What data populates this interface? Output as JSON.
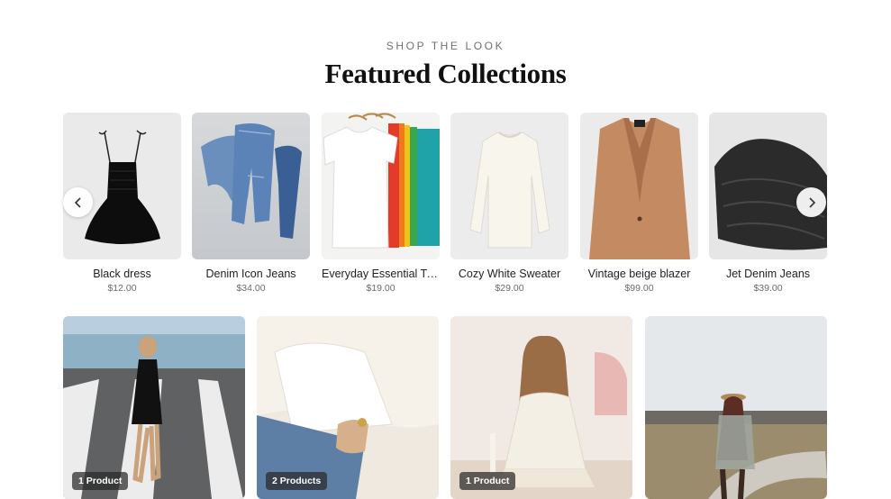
{
  "header": {
    "eyebrow": "SHOP THE LOOK",
    "title": "Featured Collections"
  },
  "carousel": {
    "prev_icon": "chevron-left-icon",
    "next_icon": "chevron-right-icon",
    "products": [
      {
        "name": "Black dress",
        "price": "$12.00",
        "image": "black dress"
      },
      {
        "name": "Denim Icon Jeans",
        "price": "$34.00",
        "image": "blue jeans"
      },
      {
        "name": "Everyday Essential T-...",
        "price": "$19.00",
        "image": "row of t-shirts"
      },
      {
        "name": "Cozy White Sweater",
        "price": "$29.00",
        "image": "white sweater"
      },
      {
        "name": "Vintage beige blazer",
        "price": "$99.00",
        "image": "beige blazer"
      },
      {
        "name": "Jet Denim Jeans",
        "price": "$39.00",
        "image": "folded black jeans"
      }
    ]
  },
  "looks": [
    {
      "badge": "1 Product",
      "image": "woman in black dress on crosswalk"
    },
    {
      "badge": "2 Products",
      "image": "white shirt and jeans close-up"
    },
    {
      "badge": "1 Product",
      "image": "woman in white sweater sitting"
    },
    {
      "badge": "",
      "image": "woman with hat walking on path"
    }
  ],
  "colors": {
    "text": "#1c1c1c",
    "muted": "#6b6b6b",
    "badge_bg": "#282828"
  }
}
